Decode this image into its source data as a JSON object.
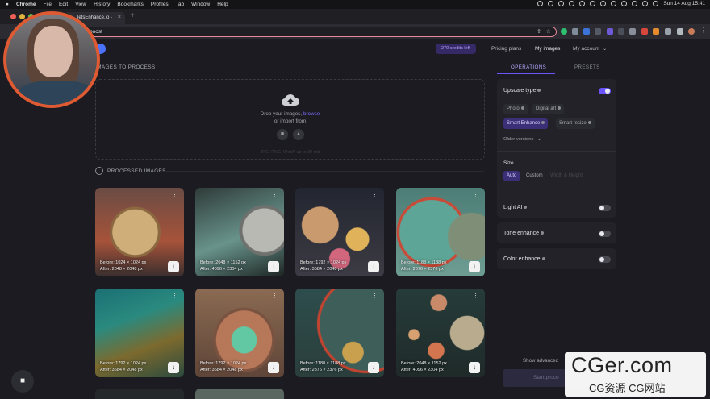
{
  "menubar": {
    "apple": "",
    "items": [
      "Chrome",
      "File",
      "Edit",
      "View",
      "History",
      "Bookmarks",
      "Profiles",
      "Tab",
      "Window",
      "Help"
    ],
    "datetime": "Sun 14 Aug  15:41"
  },
  "browser": {
    "tab_title": "letsEnhance.io -",
    "tab_close": "×",
    "new_tab": "+",
    "url": "boost"
  },
  "header": {
    "credits": "270 credits left",
    "pricing": "Pricing plans",
    "my_images": "My images",
    "my_account": "My account"
  },
  "upload": {
    "section_title": "IMAGES TO PROCESS",
    "drop_text_prefix": "Drop your images,",
    "browse_link": "browse",
    "import_text": "or import from",
    "formats": "JPG, PNG, WebP up to 30 mb"
  },
  "processed": {
    "section_title": "PROCESSED IMAGES",
    "cards": [
      {
        "before": "Before: 1024 × 1024 px",
        "after": "After: 2048 × 2048 px"
      },
      {
        "before": "Before: 2048 × 1152 px",
        "after": "After: 4096 × 2304 px"
      },
      {
        "before": "Before: 1792 × 1024 px",
        "after": "After: 3584 × 2048 px"
      },
      {
        "before": "Before: 1188 × 1188 px",
        "after": "After: 2376 × 2376 px"
      },
      {
        "before": "Before: 1792 × 1024 px",
        "after": "After: 3584 × 2048 px"
      },
      {
        "before": "Before: 1792 × 1024 px",
        "after": "After: 3584 × 2048 px"
      },
      {
        "before": "Before: 1188 × 1188 px",
        "after": "After: 2376 × 2376 px"
      },
      {
        "before": "Before: 2048 × 1152 px",
        "after": "After: 4096 × 2304 px"
      }
    ]
  },
  "panel": {
    "tab_operations": "OPERATIONS",
    "tab_presets": "PRESETS",
    "upscale_type": "Upscale type",
    "types": [
      "Photo",
      "Digital art",
      "Smart Enhance",
      "Smart resize"
    ],
    "older_versions": "Older versions",
    "size_label": "Size",
    "sizes": [
      "Auto",
      "Custom",
      "Width & Height"
    ],
    "light_ai": "Light AI",
    "tone_enhance": "Tone enhance",
    "color_enhance": "Color enhance",
    "show_advanced": "Show advanced",
    "start_button": "Start proce"
  },
  "watermark": {
    "big": "CGer.com",
    "small": "CG资源 CG网站"
  },
  "colors": {
    "accent": "#6a54ff",
    "background": "#1b1b21",
    "panel": "#222228"
  }
}
